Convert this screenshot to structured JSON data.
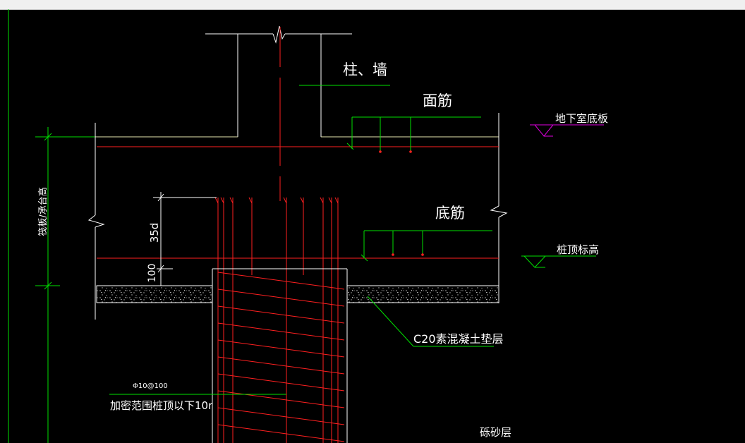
{
  "window": {
    "background": "#000000",
    "titlebar_color": "#f0f0f0"
  },
  "colors": {
    "outline": "#ffffff",
    "rebar": "#ff2020",
    "leader": "#00e000",
    "datum": "#e000e0",
    "gravel": "#b8b8b8"
  },
  "labels": {
    "column_wall": "柱、墙",
    "top_rebar": "面筋",
    "basement_floor": "地下室底板",
    "bottom_rebar": "底筋",
    "pile_top_elevation": "桩顶标高",
    "cushion": "C20素混凝土垫层",
    "raft_height": "筏板/承台高",
    "anchor_35d": "35d",
    "dim_100": "100",
    "stirrup_spec": "Φ10@100",
    "dense_range": "加密范围桩顶以下10r",
    "sand_layer": "砾砂层"
  },
  "icons": {
    "break_symbol": "break-line-icon",
    "elevation_marker": "elevation-triangle-icon"
  }
}
